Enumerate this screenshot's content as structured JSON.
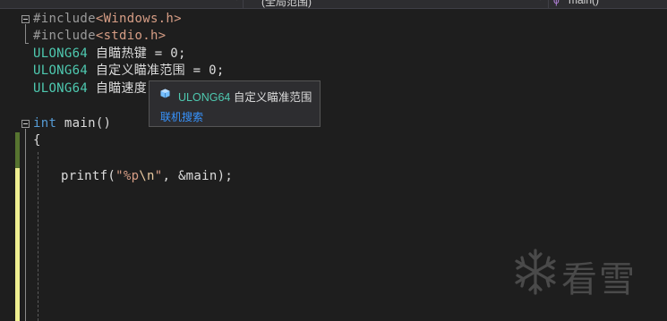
{
  "toolbar": {
    "scope_dropdown": "(全局范围)",
    "member_dropdown": "main()"
  },
  "code": {
    "l1_directive": "#include",
    "l1_header": "<Windows.h>",
    "l2_directive": "#include",
    "l2_header": "<stdio.h>",
    "l3_type": "ULONG64",
    "l3_rest": " 自瞄热键 = 0;",
    "l4_type": "ULONG64",
    "l4_rest": " 自定义瞄准范围 = 0;",
    "l5_type": "ULONG64",
    "l5_rest": " 自瞄速度",
    "l7_kw": "int",
    "l7_rest": " main()",
    "l8_brace": "{",
    "l10_fn": "printf(",
    "l10_str1": "\"%p",
    "l10_esc": "\\n",
    "l10_str2": "\"",
    "l10_rest": ", &main);"
  },
  "tooltip": {
    "icon": "variable-cube-icon",
    "type": "ULONG64",
    "name": "自定义瞄准范围",
    "link": "联机搜索"
  },
  "watermark": {
    "icon": "snowflake-icon",
    "text": "看雪"
  },
  "colors": {
    "background": "#1e1e1e",
    "type": "#4ec9b0",
    "keyword": "#569cd6",
    "string": "#d69d85",
    "link": "#3794ff",
    "changed_saved": "#577430",
    "changed_unsaved": "#efef91"
  }
}
